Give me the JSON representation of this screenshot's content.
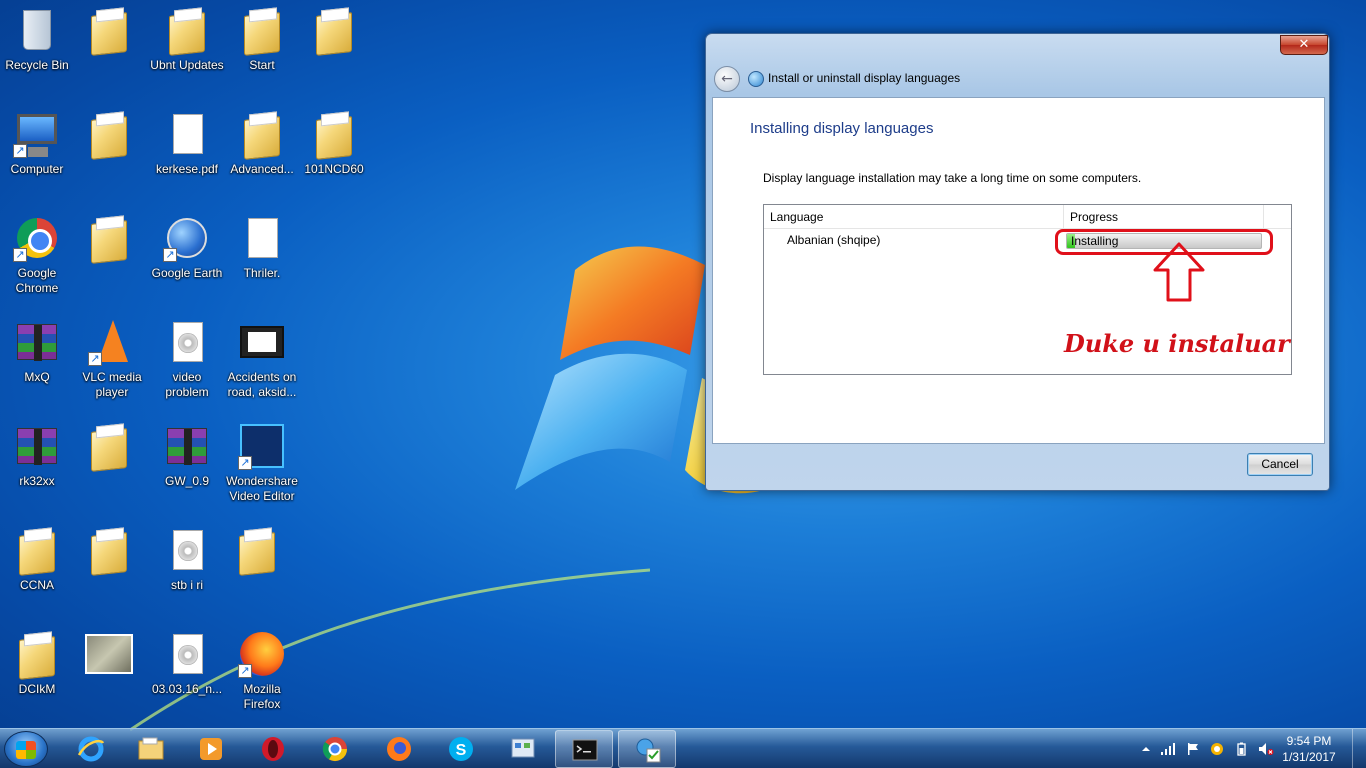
{
  "desktop": {
    "icons": [
      {
        "label": "Recycle Bin",
        "icon": "recycle-bin-icon"
      },
      {
        "label": "",
        "icon": "folder-icon"
      },
      {
        "label": "Ubnt Updates",
        "icon": "folder-icon"
      },
      {
        "label": "Start",
        "icon": "folder-icon"
      },
      {
        "label": "",
        "icon": "folder-icon"
      },
      {
        "label": "Computer",
        "icon": "computer-icon"
      },
      {
        "label": "",
        "icon": "folder-icon"
      },
      {
        "label": "kerkese.pdf",
        "icon": "pdf-file-icon"
      },
      {
        "label": "Advanced...",
        "icon": "folder-icon"
      },
      {
        "label": "101NCD60",
        "icon": "folder-icon"
      },
      {
        "label": "Google Chrome",
        "icon": "chrome-icon"
      },
      {
        "label": "",
        "icon": "folder-icon"
      },
      {
        "label": "Google Earth",
        "icon": "google-earth-icon"
      },
      {
        "label": "Thriler.",
        "icon": "text-file-icon"
      },
      {
        "label": "MxQ",
        "icon": "winrar-icon"
      },
      {
        "label": "VLC media player",
        "icon": "vlc-icon"
      },
      {
        "label": "video problem",
        "icon": "disc-file-icon"
      },
      {
        "label": "Accidents on road, aksid...",
        "icon": "video-file-icon"
      },
      {
        "label": "rk32xx",
        "icon": "winrar-icon"
      },
      {
        "label": "",
        "icon": "folder-icon"
      },
      {
        "label": "GW_0.9",
        "icon": "winrar-icon"
      },
      {
        "label": "Wondershare Video Editor",
        "icon": "wondershare-icon"
      },
      {
        "label": "CCNA",
        "icon": "folder-icon"
      },
      {
        "label": "",
        "icon": "folder-icon"
      },
      {
        "label": "stb i ri",
        "icon": "disc-file-icon"
      },
      {
        "label": "",
        "icon": "folder-icon"
      },
      {
        "label": "DCIkM",
        "icon": "folder-icon"
      },
      {
        "label": "",
        "icon": "image-file-icon"
      },
      {
        "label": "03.03.16_n...",
        "icon": "disc-file-icon"
      },
      {
        "label": "Mozilla Firefox",
        "icon": "firefox-icon"
      }
    ]
  },
  "dialog": {
    "close_label": "✕",
    "back_label": "←",
    "title": "Install or uninstall display languages",
    "heading": "Installing display languages",
    "description": "Display language installation may take a long time on some computers.",
    "columns": [
      "Language",
      "Progress"
    ],
    "rows": [
      {
        "language": "Albanian (shqipe)",
        "status": "Installing",
        "progress_fraction": 0.04
      }
    ],
    "annotation": "Duke u instaluar",
    "cancel_label": "Cancel",
    "highlight_color": "#e0101a"
  },
  "taskbar": {
    "items": [
      {
        "name": "internet-explorer",
        "active": false
      },
      {
        "name": "windows-explorer",
        "active": false
      },
      {
        "name": "media-player",
        "active": false
      },
      {
        "name": "opera",
        "active": false
      },
      {
        "name": "chrome",
        "active": false
      },
      {
        "name": "firefox",
        "active": false
      },
      {
        "name": "skype",
        "active": false
      },
      {
        "name": "control-panel",
        "active": false
      },
      {
        "name": "command-prompt",
        "active": true
      },
      {
        "name": "region-language",
        "active": true
      }
    ],
    "time": "9:54 PM",
    "date": "1/31/2017"
  }
}
